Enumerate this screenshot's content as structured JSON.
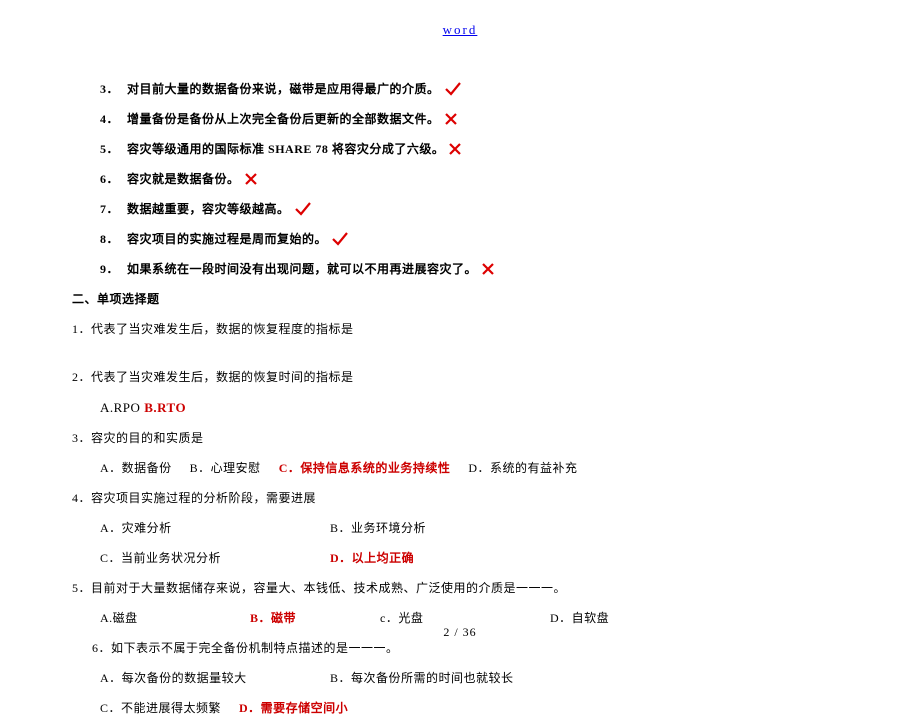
{
  "header": {
    "link_text": "word"
  },
  "tf": {
    "items": [
      {
        "num": "3．",
        "text": "对目前大量的数据备份来说，磁带是应用得最广的介质。",
        "mark": "tick"
      },
      {
        "num": "4．",
        "text": "增量备份是备份从上次完全备份后更新的全部数据文件。",
        "mark": "cross"
      },
      {
        "num": "5．",
        "text": "容灾等级通用的国际标准 SHARE 78 将容灾分成了六级。",
        "mark": "cross"
      },
      {
        "num": "6．",
        "text": "容灾就是数据备份。",
        "mark": "cross"
      },
      {
        "num": "7．",
        "text": "数据越重要，容灾等级越高。",
        "mark": "tick"
      },
      {
        "num": "8．",
        "text": "容灾项目的实施过程是周而复始的。",
        "mark": "tick"
      },
      {
        "num": "9．",
        "text": "如果系统在一段时间没有出现问题，就可以不用再进展容灾了。",
        "mark": "cross"
      }
    ]
  },
  "mc": {
    "title": "二、单项选择题",
    "q1": {
      "stem": "1．代表了当灾难发生后，数据的恢复程度的指标是"
    },
    "q2": {
      "stem": "2．代表了当灾难发生后，数据的恢复时间的指标是",
      "ans_prefix": "A.RPO ",
      "ans_highlight": "B.RTO"
    },
    "q3": {
      "stem": "3．容灾的目的和实质是",
      "opts": {
        "a": "A．数据备份",
        "b": "B．心理安慰",
        "c": "C．保持信息系统的业务持续性",
        "d": "D．系统的有益补充"
      }
    },
    "q4": {
      "stem": "4．容灾项目实施过程的分析阶段，需要进展",
      "opts": {
        "a": "A．灾难分析",
        "b": "B．业务环境分析",
        "c": "C．当前业务状况分析",
        "d": "D．以上均正确"
      }
    },
    "q5": {
      "stem": "5．目前对于大量数据储存来说，容量大、本钱低、技术成熟、广泛使用的介质是一一一。",
      "opts": {
        "a": "A.磁盘",
        "b": "B．磁带",
        "c": "c．光盘",
        "d": "D．自软盘"
      }
    },
    "q6": {
      "stem": "6．如下表示不属于完全备份机制特点描述的是一一一。",
      "opts": {
        "a": "A．每次备份的数据量较大",
        "b": "B．每次备份所需的时间也就较长",
        "c": "C．不能进展得太频繁",
        "d": "D．需要存储空间小"
      }
    }
  },
  "footer": {
    "page": "2 / 36"
  }
}
